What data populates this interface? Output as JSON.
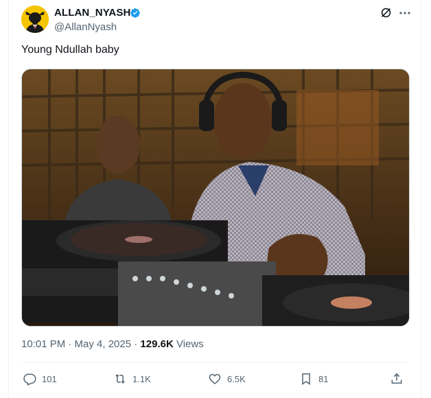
{
  "post": {
    "author_name": "ALLAN_NYASH",
    "handle": "@AllanNyash",
    "text": "Young Ndullah  baby",
    "timestamp": "10:01 PM · May 4, 2025 · ",
    "views_count": "129.6K",
    "views_label": " Views",
    "media_alt": "Photo of a man DJing at turntables and mixer with another man standing behind him"
  },
  "actions": {
    "replies": "101",
    "reposts": "1.1K",
    "likes": "6.5K",
    "bookmarks": "81"
  },
  "icons": {
    "verified": "verified-badge-icon",
    "grok": "grok-icon",
    "more": "more-icon",
    "reply": "reply-icon",
    "repost": "repost-icon",
    "like": "like-icon",
    "bookmark": "bookmark-icon",
    "share": "share-icon"
  },
  "colors": {
    "verified": "#1d9bf0",
    "text": "#0f1419",
    "secondary": "#536471",
    "avatar_bg": "#f5c400"
  }
}
